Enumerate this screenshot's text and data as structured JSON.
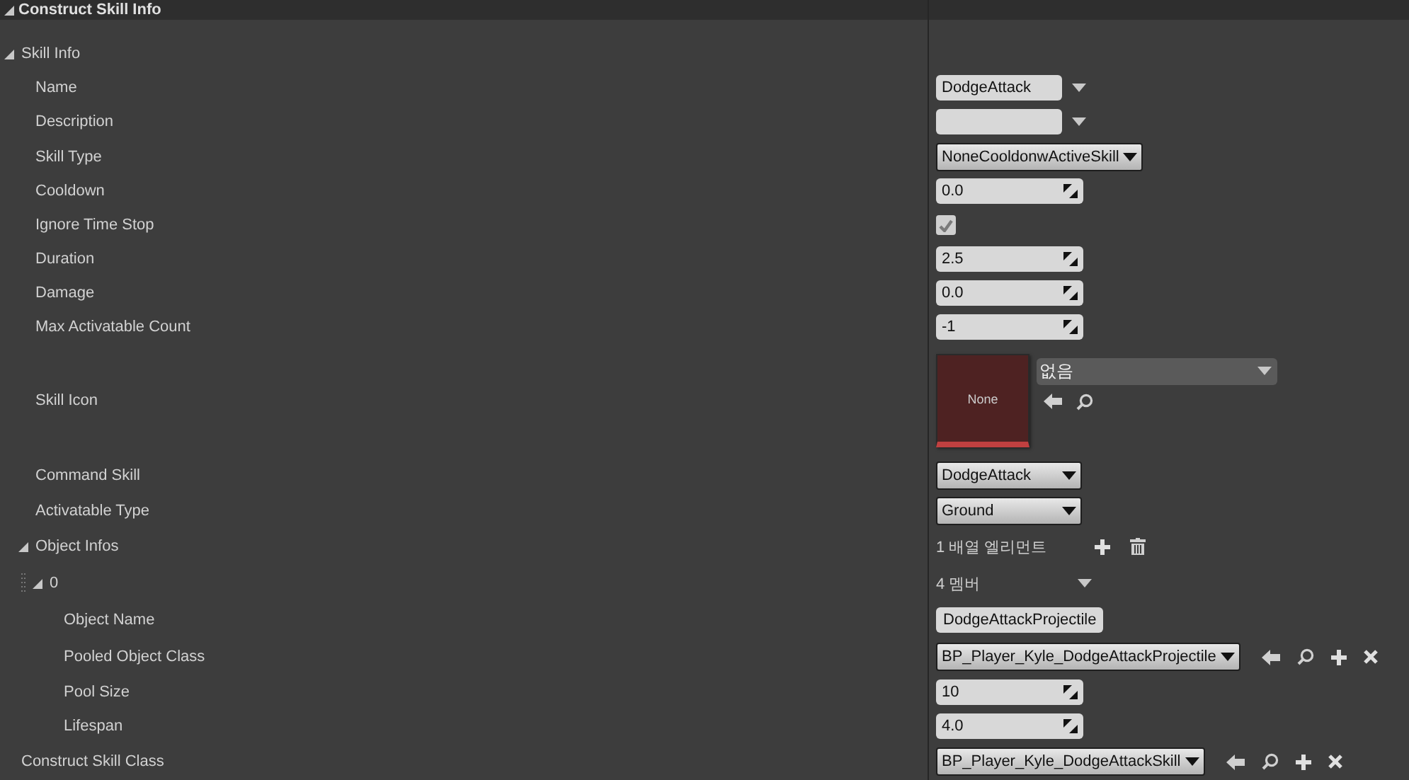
{
  "panel": {
    "title": "Construct Skill Info",
    "expanded": true
  },
  "rows": [
    {
      "kind": "category",
      "label": "Skill Info",
      "expanded": true,
      "children": [
        {
          "kind": "text",
          "label": "Name",
          "value": "DodgeAttack"
        },
        {
          "kind": "text",
          "label": "Description"
        },
        {
          "kind": "enum",
          "label": "Skill Type",
          "value": "NoneCooldonwActiveSkill"
        },
        {
          "kind": "number",
          "label": "Cooldown",
          "value": "0.0"
        },
        {
          "kind": "checkbox",
          "label": "Ignore Time Stop",
          "checked": true
        },
        {
          "kind": "number",
          "label": "Duration",
          "value": "2.5"
        },
        {
          "kind": "number",
          "label": "Damage",
          "value": "0.0"
        },
        {
          "kind": "number",
          "label": "Max Activatable Count",
          "value": "-1"
        },
        {
          "kind": "asset",
          "label": "Skill Icon",
          "thumbnail": "None",
          "value": "없음"
        },
        {
          "kind": "enum",
          "label": "Command Skill",
          "value": "DodgeAttack"
        },
        {
          "kind": "enum",
          "label": "Activatable Type",
          "value": "Ground"
        },
        {
          "kind": "array",
          "label": "Object Infos",
          "expanded": true,
          "summary": "1 배열 엘리먼트",
          "children": [
            {
              "kind": "struct",
              "label": "0",
              "expanded": true,
              "summary": "4 멤버",
              "children": [
                {
                  "kind": "string",
                  "label": "Object Name",
                  "value": "DodgeAttackProjectile"
                },
                {
                  "kind": "class",
                  "label": "Pooled Object Class",
                  "value": "BP_Player_Kyle_DodgeAttackProjectile"
                },
                {
                  "kind": "number",
                  "label": "Pool Size",
                  "value": "10"
                },
                {
                  "kind": "number",
                  "label": "Lifespan",
                  "value": "4.0"
                }
              ]
            }
          ]
        }
      ]
    },
    {
      "kind": "class",
      "label": "Construct Skill Class",
      "value": "BP_Player_Kyle_DodgeAttackSkill"
    }
  ]
}
